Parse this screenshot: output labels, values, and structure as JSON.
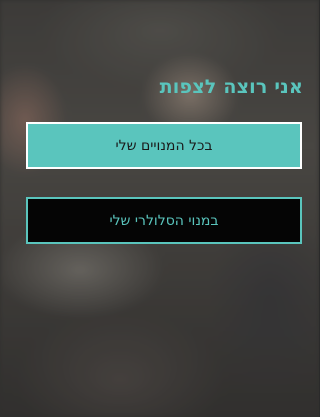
{
  "colors": {
    "accent": "#5ac5bd",
    "selected_text": "#1a1a1a",
    "unselected_bg": "#050505"
  },
  "screen": {
    "title": "אני רוצה לצפות"
  },
  "options": [
    {
      "label": "בכל המנויים שלי",
      "selected": true
    },
    {
      "label": "במנוי הסלולרי שלי",
      "selected": false
    }
  ]
}
